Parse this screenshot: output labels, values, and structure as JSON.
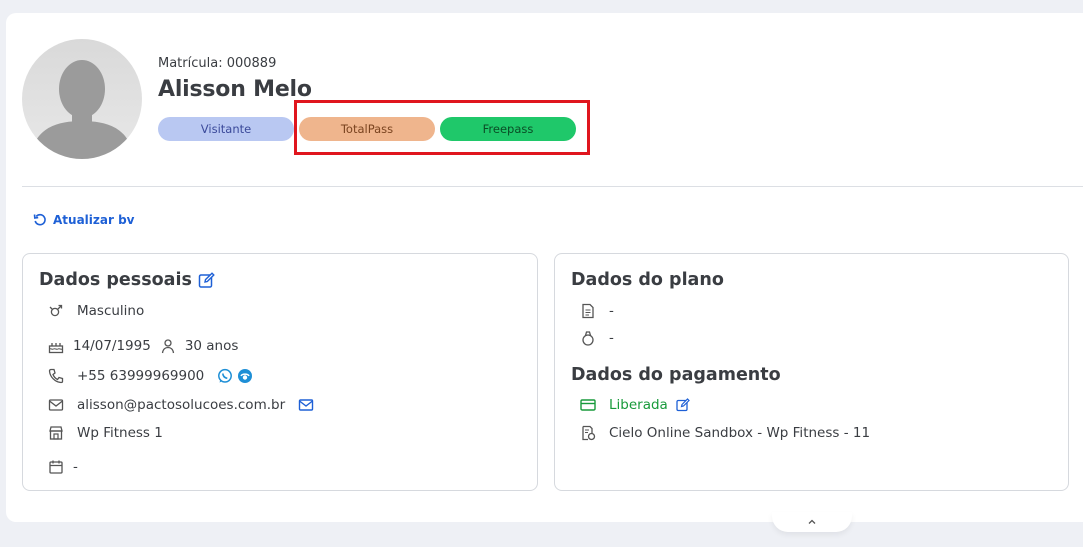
{
  "profile": {
    "matricula": "Matrícula: 000889",
    "name": "Alisson Melo",
    "badges": [
      "Visitante",
      "TotalPass",
      "Freepass"
    ]
  },
  "actions": {
    "refresh_label": "Atualizar bv"
  },
  "personal": {
    "title": "Dados pessoais",
    "gender": "Masculino",
    "birthdate": "14/07/1995",
    "age": "30 anos",
    "phone": "+55 63999969900",
    "email": "alisson@pactosolucoes.com.br",
    "unit": "Wp Fitness 1",
    "date": "-"
  },
  "plan": {
    "title": "Dados do plano",
    "contract": "-",
    "package": "-"
  },
  "payment": {
    "title": "Dados do pagamento",
    "status": "Liberada",
    "gateway": "Cielo Online Sandbox - Wp Fitness - 11"
  },
  "colors": {
    "accent": "#1e60d6",
    "visitante": "#b9c8f2",
    "totalpass": "#efb58d",
    "freepass": "#1fc86a",
    "highlight": "#e0161e",
    "status_ok": "#189a3b"
  }
}
